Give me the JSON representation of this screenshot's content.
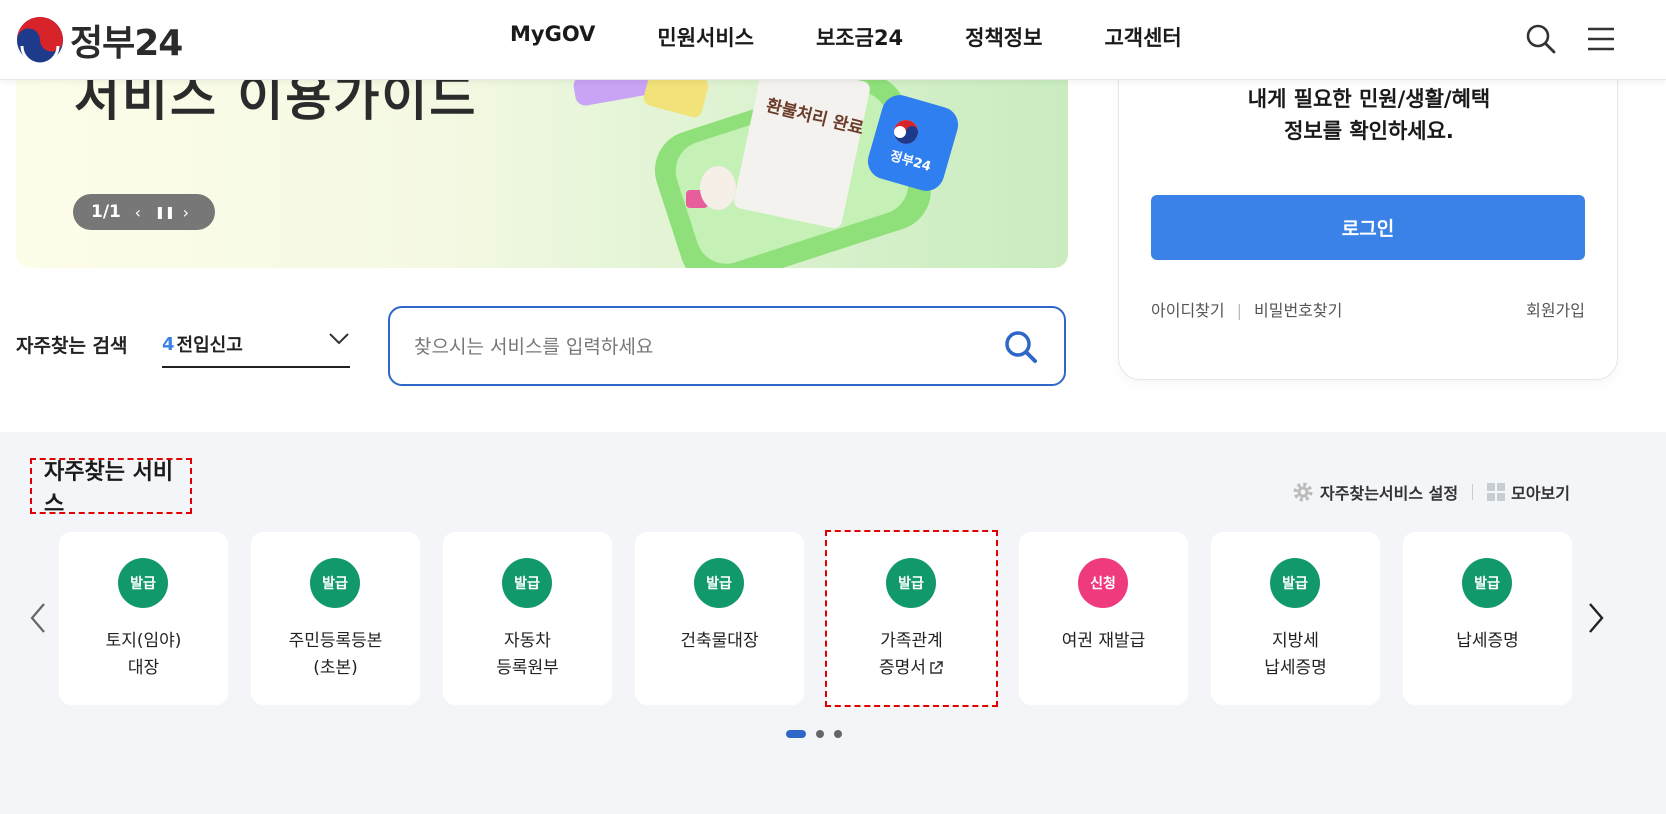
{
  "header": {
    "logo_text": "정부24",
    "nav": [
      "MyGOV",
      "민원서비스",
      "보조금24",
      "정책정보",
      "고객센터"
    ],
    "icons": [
      "search-icon",
      "menu-icon"
    ]
  },
  "banner": {
    "title": "서비스 이용가이드",
    "slide_counter": "1/1",
    "receipt_text": "환불처리 완료",
    "badge_text": "정부24"
  },
  "login": {
    "message_line1": "내게 필요한 민원/생활/혜택",
    "message_line2": "정보를 확인하세요.",
    "button": "로그인",
    "find_id": "아이디찾기",
    "find_pw": "비밀번호찾기",
    "signup": "회원가입",
    "button_color": "#3b82e8"
  },
  "search": {
    "frequent_label": "자주찾는 검색",
    "frequent_rank": "4",
    "frequent_term": "전입신고",
    "placeholder": "찾으시는 서비스를 입력하세요"
  },
  "services": {
    "title": "자주찾는 서비스",
    "settings": "자주찾는서비스 설정",
    "view_all": "모아보기",
    "cards": [
      {
        "badge": "발급",
        "line1": "토지(임야)",
        "line2": "대장",
        "badge_color": "#11996b"
      },
      {
        "badge": "발급",
        "line1": "주민등록등본",
        "line2": "(초본)",
        "badge_color": "#11996b"
      },
      {
        "badge": "발급",
        "line1": "자동차",
        "line2": "등록원부",
        "badge_color": "#11996b"
      },
      {
        "badge": "발급",
        "line1": "건축물대장",
        "line2": "",
        "badge_color": "#11996b"
      },
      {
        "badge": "발급",
        "line1": "가족관계",
        "line2": "증명서",
        "external": true,
        "badge_color": "#11996b"
      },
      {
        "badge": "신청",
        "line1": "여권 재발급",
        "line2": "",
        "badge_color": "#ef3a7e"
      },
      {
        "badge": "발급",
        "line1": "지방세",
        "line2": "납세증명",
        "badge_color": "#11996b"
      },
      {
        "badge": "발급",
        "line1": "납세증명",
        "line2": "",
        "badge_color": "#11996b"
      }
    ],
    "pages": 3,
    "active_page": 1
  }
}
